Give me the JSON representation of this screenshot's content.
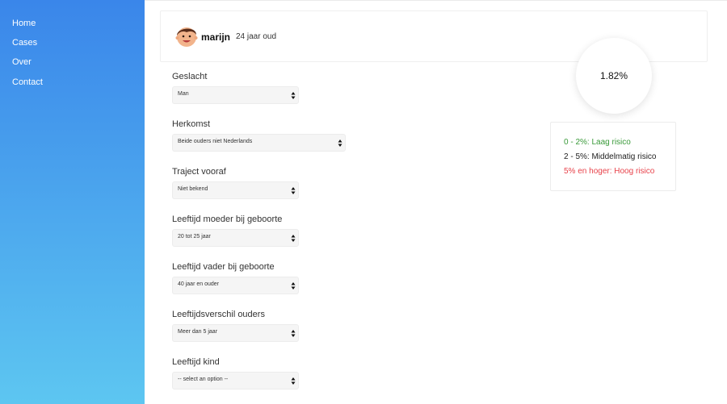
{
  "nav": {
    "items": [
      {
        "label": "Home"
      },
      {
        "label": "Cases"
      },
      {
        "label": "Over"
      },
      {
        "label": "Contact"
      }
    ]
  },
  "profile": {
    "name": "marijn",
    "age": "24 jaar oud",
    "avatar_icon": "boy-avatar-icon"
  },
  "fields": [
    {
      "label": "Geslacht",
      "value": "Man"
    },
    {
      "label": "Herkomst",
      "value": "Beide ouders niet Nederlands"
    },
    {
      "label": "Traject vooraf",
      "value": "Niet bekend"
    },
    {
      "label": "Leeftijd moeder bij geboorte",
      "value": "20 tot 25 jaar"
    },
    {
      "label": "Leeftijd vader bij geboorte",
      "value": "40 jaar en ouder"
    },
    {
      "label": "Leeftijdsverschil ouders",
      "value": "Meer dan 5 jaar"
    },
    {
      "label": "Leeftijd kind",
      "value": "-- select an option --"
    }
  ],
  "score": {
    "value": "1.82%"
  },
  "legend": [
    {
      "text": "0 - 2%: Laag risico",
      "color": "#3a9a3a"
    },
    {
      "text": "2 - 5%: Middelmatig risico",
      "color": "#222222"
    },
    {
      "text": "5% en hoger: Hoog risico",
      "color": "#e8424a"
    }
  ],
  "colors": {
    "sidebar_top": "#3a86ea",
    "sidebar_bottom": "#5dc6f1"
  }
}
